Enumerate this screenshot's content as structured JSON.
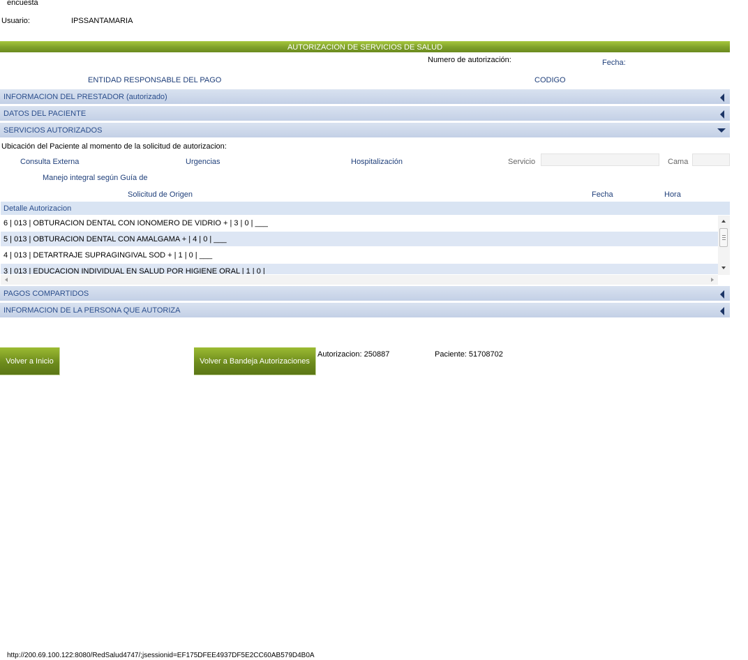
{
  "header": {
    "top_label": "encuesta",
    "user_label": "Usuario:",
    "user_value": "IPSSANTAMARIA"
  },
  "form": {
    "title": "AUTORIZACION DE SERVICIOS DE SALUD",
    "auth_number_label": "Numero de autorización:",
    "date_label": "Fecha:",
    "entity_label": "ENTIDAD RESPONSABLE DEL PAGO",
    "code_label": "CODIGO"
  },
  "sections": {
    "prestador": "INFORMACION DEL PRESTADOR (autorizado)",
    "paciente": "DATOS DEL PACIENTE",
    "servicios": "SERVICIOS AUTORIZADOS",
    "pagos": "PAGOS COMPARTIDOS",
    "persona": "INFORMACION DE LA PERSONA QUE AUTORIZA"
  },
  "servicios": {
    "ubicacion_label": "Ubicación del Paciente al momento de la solicitud de autorizacion:",
    "consulta_externa": "Consulta Externa",
    "urgencias": "Urgencias",
    "hospitalizacion": "Hospitalización",
    "servicio_label": "Servicio",
    "servicio_value": "",
    "cama_label": "Cama",
    "cama_value": "",
    "manejo_label": "Manejo integral según Guía de",
    "solicitud_label": "Solicitud de Origen",
    "fecha_label": "Fecha",
    "hora_label": "Hora",
    "detalle_header": "Detalle Autorizacion",
    "rows": [
      "6 | 013 | OBTURACION DENTAL CON IONOMERO DE VIDRIO + | 3 | 0 | ___",
      "5 | 013 | OBTURACION DENTAL CON AMALGAMA + | 4 | 0 | ___",
      "4 | 013 | DETARTRAJE SUPRAGINGIVAL SOD + | 1 | 0 | ___",
      "3 | 013 | EDUCACION INDIVIDUAL EN SALUD POR HIGIENE ORAL | 1 | 0 |"
    ]
  },
  "footer": {
    "btn_inicio": "Volver a Inicio",
    "btn_bandeja": "Volver a Bandeja Autorizaciones",
    "autorizacion": "Autorizacion: 250887",
    "paciente": "Paciente: 51708702"
  },
  "status_bar": {
    "url": "http://200.69.100.122:8080/RedSalud4747/;jsessionid=EF175DFEE4937DF5E2CC60AB579D4B0A"
  }
}
